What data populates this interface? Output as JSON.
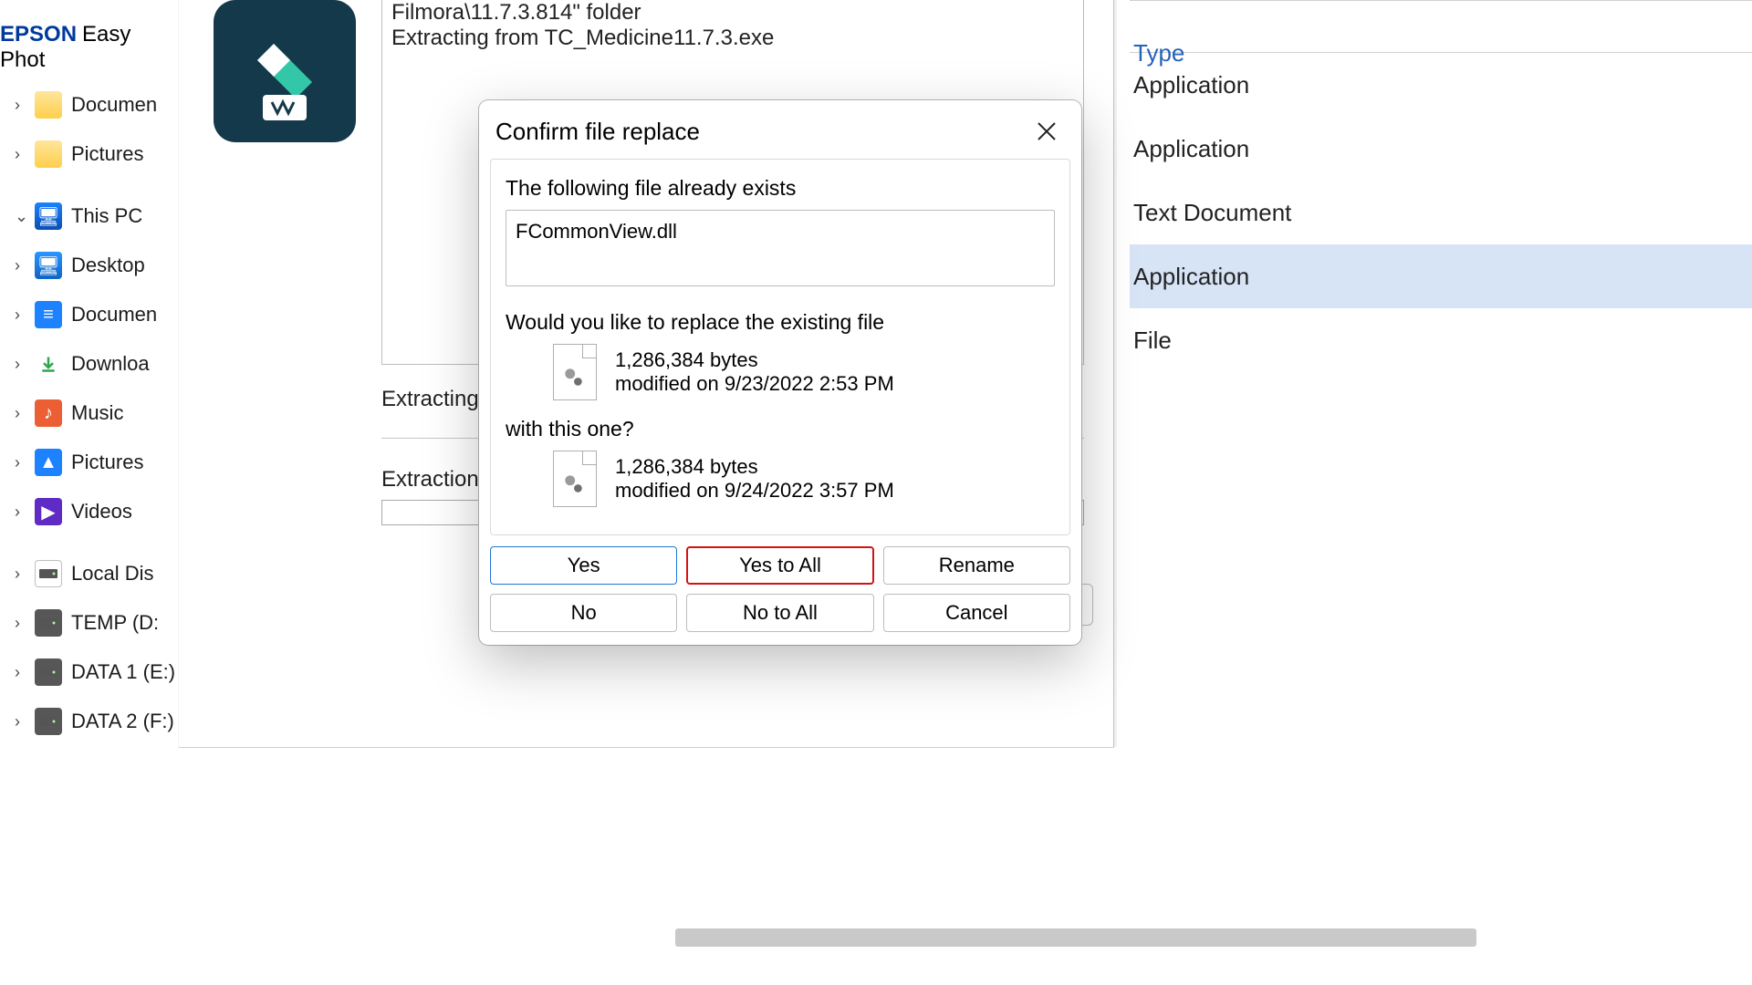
{
  "nav_tree": {
    "brand_prefix": "EPSON",
    "brand_suffix": "Easy Phot",
    "items": [
      {
        "label": "Documen",
        "icon": "folder",
        "chev": "›"
      },
      {
        "label": "Pictures",
        "icon": "folder",
        "chev": "›"
      },
      {
        "label": "This PC",
        "icon": "pc",
        "chev": "⌄"
      },
      {
        "label": "Desktop",
        "icon": "desk",
        "chev": "›"
      },
      {
        "label": "Documen",
        "icon": "doc",
        "chev": "›"
      },
      {
        "label": "Downloa",
        "icon": "dl",
        "chev": "›"
      },
      {
        "label": "Music",
        "icon": "music",
        "chev": "›"
      },
      {
        "label": "Pictures",
        "icon": "pic",
        "chev": "›"
      },
      {
        "label": "Videos",
        "icon": "vid",
        "chev": "›"
      },
      {
        "label": "Local Dis",
        "icon": "drivew",
        "chev": "›"
      },
      {
        "label": "TEMP (D:",
        "icon": "drive",
        "chev": "›"
      },
      {
        "label": "DATA 1 (E:)",
        "icon": "drive",
        "chev": "›"
      },
      {
        "label": "DATA 2 (F:)",
        "icon": "drive",
        "chev": "›"
      }
    ]
  },
  "installer": {
    "log_line1": "Filmora\\11.7.3.814\" folder",
    "log_line2": "Extracting from TC_Medicine11.7.3.exe",
    "label_extracting": "Extracting F",
    "label_progress": "Extraction p"
  },
  "type_column": {
    "header": "Type",
    "rows": [
      {
        "text": "Application",
        "selected": false
      },
      {
        "text": "Application",
        "selected": false
      },
      {
        "text": "Text Document",
        "selected": false
      },
      {
        "text": "Application",
        "selected": true
      },
      {
        "text": "File",
        "selected": false
      }
    ]
  },
  "dialog": {
    "title": "Confirm file replace",
    "line_exists": "The following file already exists",
    "filename": "FCommonView.dll",
    "line_replace": "Would you like to replace the existing file",
    "existing": {
      "size": "1,286,384 bytes",
      "modified": "modified on 9/23/2022 2:53 PM"
    },
    "line_with": "with this one?",
    "incoming": {
      "size": "1,286,384 bytes",
      "modified": "modified on 9/24/2022 3:57 PM"
    },
    "buttons": {
      "yes": "Yes",
      "yes_all": "Yes to All",
      "rename": "Rename",
      "no": "No",
      "no_all": "No to All",
      "cancel": "Cancel"
    }
  }
}
